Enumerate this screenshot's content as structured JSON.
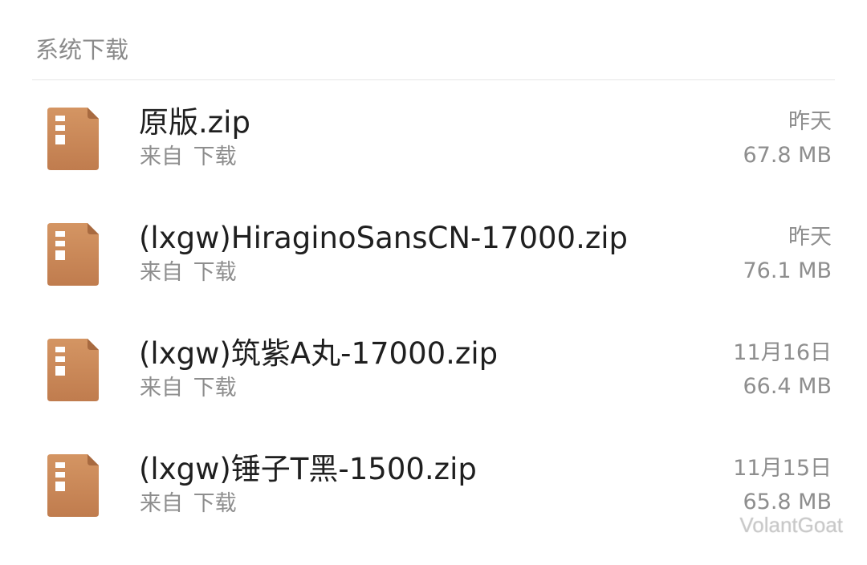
{
  "section": {
    "title": "系统下载"
  },
  "files": [
    {
      "name": "原版.zip",
      "source": "来自 下载",
      "date": "昨天",
      "size": "67.8 MB",
      "icon": "archive-file-icon"
    },
    {
      "name": "(lxgw)HiraginoSansCN-17000.zip",
      "source": "来自 下载",
      "date": "昨天",
      "size": "76.1 MB",
      "icon": "archive-file-icon"
    },
    {
      "name": "(lxgw)筑紫A丸-17000.zip",
      "source": "来自 下载",
      "date": "11月16日",
      "size": "66.4 MB",
      "icon": "archive-file-icon"
    },
    {
      "name": "(lxgw)锤子T黑-1500.zip",
      "source": "来自 下载",
      "date": "11月15日",
      "size": "65.8 MB",
      "icon": "archive-file-icon"
    }
  ],
  "watermark": "VolantGoat",
  "colors": {
    "icon_body": "#c9875a",
    "icon_fold": "#a86a40",
    "primary_text": "#1f1f1f",
    "secondary_text": "#8e8e8e",
    "header_text": "#8a8a8a",
    "divider": "#e6e6e6"
  }
}
